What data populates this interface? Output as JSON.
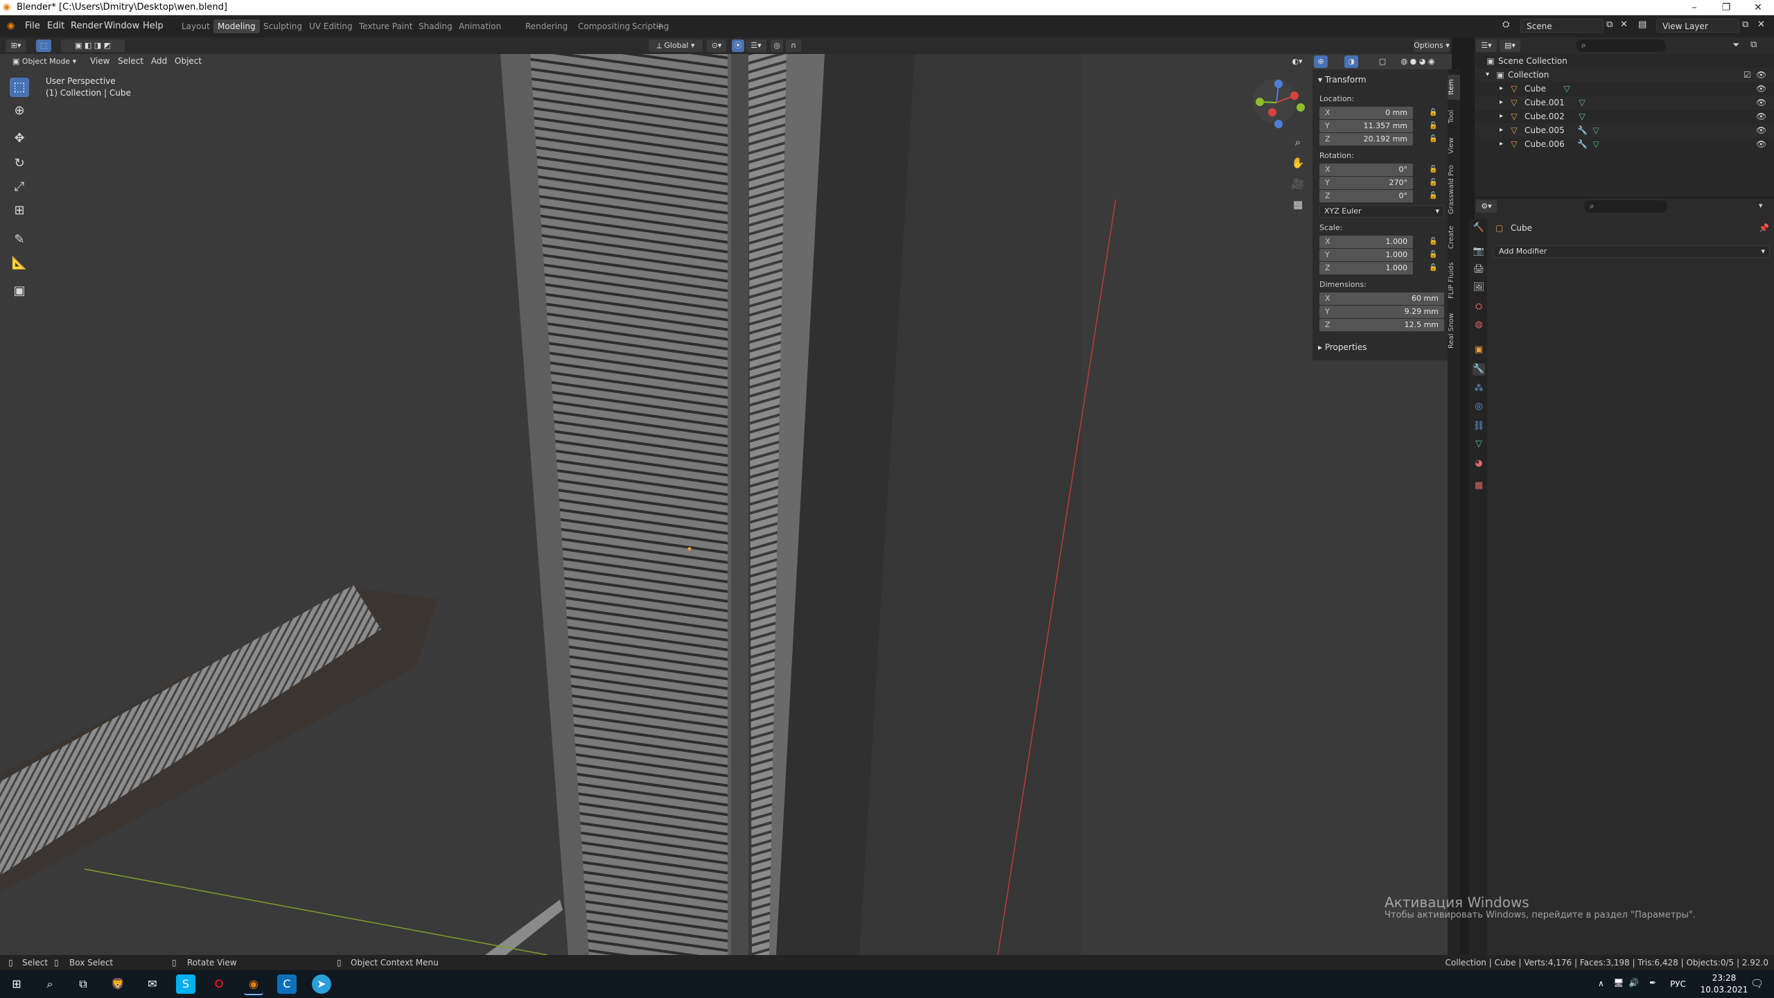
{
  "window": {
    "title": "Blender* [C:\\Users\\Dmitry\\Desktop\\wen.blend]"
  },
  "menu": [
    "File",
    "Edit",
    "Render",
    "Window",
    "Help"
  ],
  "workspaces": [
    "Layout",
    "Modeling",
    "Sculpting",
    "UV Editing",
    "Texture Paint",
    "Shading",
    "Animation",
    "Rendering",
    "Compositing",
    "Scripting"
  ],
  "active_workspace": "Modeling",
  "scene_field": "Scene",
  "view_layer_field": "View Layer",
  "tool_header": {
    "transform_orientation": "Global",
    "options_label": "Options"
  },
  "viewport_header": {
    "mode": "Object Mode",
    "menus": [
      "View",
      "Select",
      "Add",
      "Object"
    ]
  },
  "viewport_overlay": {
    "view_name": "User Perspective",
    "collection": "(1) Collection | Cube"
  },
  "npanel": {
    "transform_header": "Transform",
    "location_label": "Location:",
    "location": [
      {
        "axis": "X",
        "value": "0 mm"
      },
      {
        "axis": "Y",
        "value": "11.357 mm"
      },
      {
        "axis": "Z",
        "value": "20.192 mm"
      }
    ],
    "rotation_label": "Rotation:",
    "rotation": [
      {
        "axis": "X",
        "value": "0°"
      },
      {
        "axis": "Y",
        "value": "270°"
      },
      {
        "axis": "Z",
        "value": "0°"
      }
    ],
    "rotation_mode": "XYZ Euler",
    "scale_label": "Scale:",
    "scale": [
      {
        "axis": "X",
        "value": "1.000"
      },
      {
        "axis": "Y",
        "value": "1.000"
      },
      {
        "axis": "Z",
        "value": "1.000"
      }
    ],
    "dimensions_label": "Dimensions:",
    "dimensions": [
      {
        "axis": "X",
        "value": "60 mm"
      },
      {
        "axis": "Y",
        "value": "9.29 mm"
      },
      {
        "axis": "Z",
        "value": "12.5 mm"
      }
    ],
    "properties_header": "Properties"
  },
  "npanel_tabs": [
    "Item",
    "Tool",
    "View",
    "Grasswald Pro",
    "Create",
    "FLIP Fluids",
    "Real Snow"
  ],
  "outliner": {
    "scene_collection": "Scene Collection",
    "collection": "Collection",
    "objects": [
      "Cube",
      "Cube.001",
      "Cube.002",
      "Cube.005",
      "Cube.006"
    ]
  },
  "properties": {
    "object_name": "Cube",
    "add_modifier": "Add Modifier"
  },
  "statusbar": {
    "select": "Select",
    "box_select": "Box Select",
    "rotate_view": "Rotate View",
    "context_menu": "Object Context Menu",
    "stats": "Collection | Cube | Verts:4,176 | Faces:3,198 | Tris:6,428 | Objects:0/5 | 2.92.0"
  },
  "watermark": {
    "line1": "Активация Windows",
    "line2": "Чтобы активировать Windows, перейдите в раздел \"Параметры\"."
  },
  "taskbar": {
    "language": "РУС",
    "time": "23:28",
    "date": "10.03.2021"
  },
  "colors": {
    "accent_blue": "#4772b3",
    "axis_red": "#d8423f",
    "axis_green": "#8cbf2e",
    "object_orange": "#e8a03c"
  }
}
